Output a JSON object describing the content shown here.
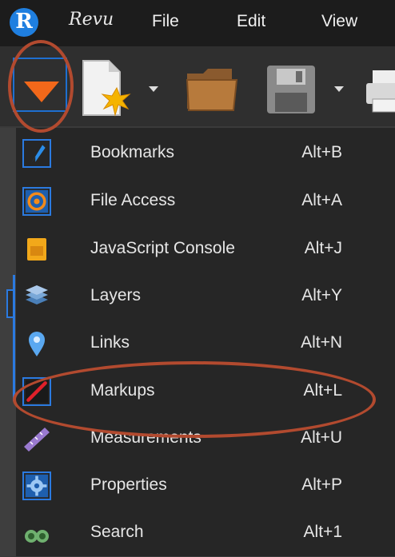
{
  "menubar": {
    "logo_letter": "R",
    "brand": "Revu",
    "items": [
      "File",
      "Edit",
      "View"
    ]
  },
  "toolbar": {
    "buttons": [
      {
        "name": "menu-dropdown",
        "icon": "orange-down-triangle-icon"
      },
      {
        "name": "new-document",
        "icon": "new-document-icon"
      },
      {
        "name": "open",
        "icon": "folder-icon"
      },
      {
        "name": "save",
        "icon": "floppy-disk-icon"
      },
      {
        "name": "print",
        "icon": "printer-icon"
      }
    ]
  },
  "dropdown": {
    "items": [
      {
        "label": "Bookmarks",
        "shortcut": "Alt+B",
        "icon": "bookmark-icon"
      },
      {
        "label": "File Access",
        "shortcut": "Alt+A",
        "icon": "file-access-icon"
      },
      {
        "label": "JavaScript Console",
        "shortcut": "Alt+J",
        "icon": "javascript-icon"
      },
      {
        "label": "Layers",
        "shortcut": "Alt+Y",
        "icon": "layers-icon"
      },
      {
        "label": "Links",
        "shortcut": "Alt+N",
        "icon": "link-pin-icon"
      },
      {
        "label": "Markups",
        "shortcut": "Alt+L",
        "icon": "markup-pen-icon"
      },
      {
        "label": "Measurements",
        "shortcut": "Alt+U",
        "icon": "ruler-icon"
      },
      {
        "label": "Properties",
        "shortcut": "Alt+P",
        "icon": "gear-icon"
      },
      {
        "label": "Search",
        "shortcut": "Alt+1",
        "icon": "binoculars-icon"
      }
    ]
  },
  "colors": {
    "accent_blue": "#2b7ae0",
    "callout_ring": "#b24a2f",
    "dropdown_arrow": "#f2681a",
    "markup_red": "#e0202a"
  }
}
